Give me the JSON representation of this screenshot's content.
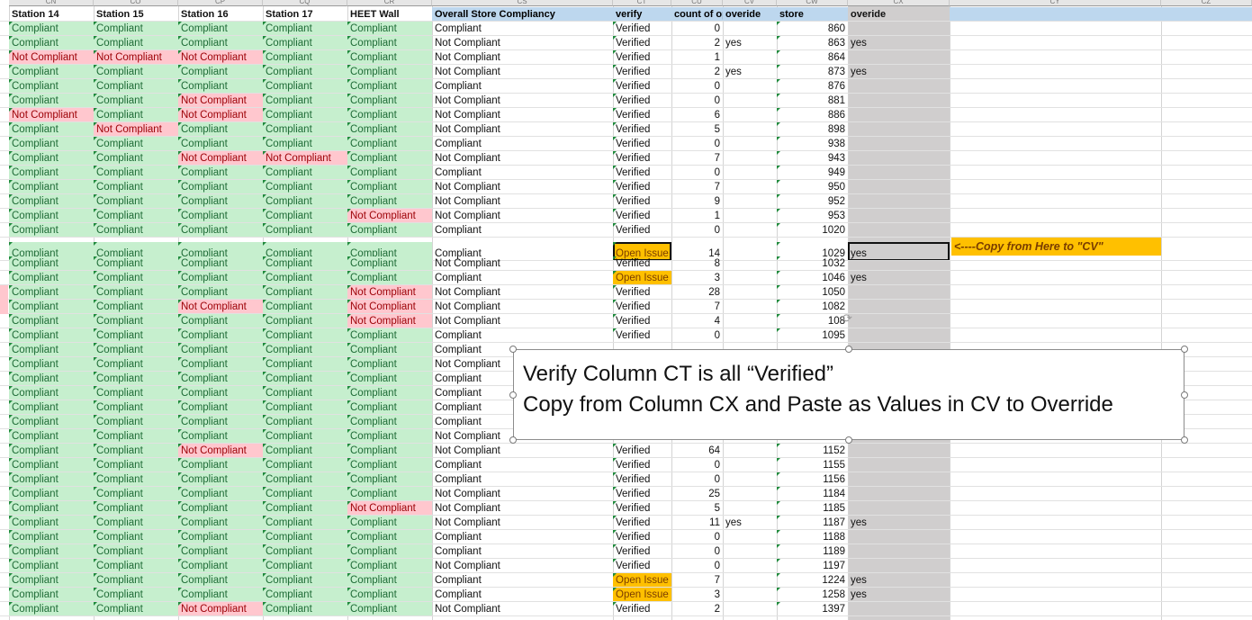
{
  "column_letters": [
    "CN",
    "CO",
    "CP",
    "CQ",
    "CR",
    "CS",
    "CT",
    "CU",
    "CV",
    "CW",
    "CX",
    "CY",
    "CZ"
  ],
  "headers": {
    "station14": "Station 14",
    "station15": "Station 15",
    "station16": "Station 16",
    "station17": "Station 17",
    "heet": "HEET Wall",
    "overall": "Overall Store Compliancy",
    "verify": "verify",
    "count": "count of op",
    "override1": "overide",
    "store": "store",
    "override2": "overide"
  },
  "labels": {
    "compliant": "Compliant",
    "not_compliant": "Not Compliant",
    "verified": "Verified",
    "open_issue": "Open Issue",
    "yes": "yes"
  },
  "rows": [
    {
      "st": [
        "C",
        "C",
        "C",
        "C",
        "C"
      ],
      "overall": "C",
      "verify": "V",
      "count": "0",
      "ov": "",
      "store": "860",
      "cx": ""
    },
    {
      "st": [
        "C",
        "C",
        "C",
        "C",
        "C"
      ],
      "overall": "N",
      "verify": "V",
      "count": "2",
      "ov": "yes",
      "store": "863",
      "cx": "yes"
    },
    {
      "st": [
        "N",
        "N",
        "N",
        "C",
        "C"
      ],
      "overall": "N",
      "verify": "V",
      "count": "1",
      "ov": "",
      "store": "864",
      "cx": ""
    },
    {
      "st": [
        "C",
        "C",
        "C",
        "C",
        "C"
      ],
      "overall": "N",
      "verify": "V",
      "count": "2",
      "ov": "yes",
      "store": "873",
      "cx": "yes"
    },
    {
      "st": [
        "C",
        "C",
        "C",
        "C",
        "C"
      ],
      "overall": "C",
      "verify": "V",
      "count": "0",
      "ov": "",
      "store": "876",
      "cx": ""
    },
    {
      "st": [
        "C",
        "C",
        "N",
        "C",
        "C"
      ],
      "overall": "N",
      "verify": "V",
      "count": "0",
      "ov": "",
      "store": "881",
      "cx": ""
    },
    {
      "st": [
        "N",
        "C",
        "N",
        "C",
        "C"
      ],
      "overall": "N",
      "verify": "V",
      "count": "6",
      "ov": "",
      "store": "886",
      "cx": ""
    },
    {
      "st": [
        "C",
        "N",
        "C",
        "C",
        "C"
      ],
      "overall": "N",
      "verify": "V",
      "count": "5",
      "ov": "",
      "store": "898",
      "cx": ""
    },
    {
      "st": [
        "C",
        "C",
        "C",
        "C",
        "C"
      ],
      "overall": "C",
      "verify": "V",
      "count": "0",
      "ov": "",
      "store": "938",
      "cx": ""
    },
    {
      "st": [
        "C",
        "C",
        "N",
        "N",
        "C"
      ],
      "overall": "N",
      "verify": "V",
      "count": "7",
      "ov": "",
      "store": "943",
      "cx": ""
    },
    {
      "st": [
        "C",
        "C",
        "C",
        "C",
        "C"
      ],
      "overall": "C",
      "verify": "V",
      "count": "0",
      "ov": "",
      "store": "949",
      "cx": ""
    },
    {
      "st": [
        "C",
        "C",
        "C",
        "C",
        "C"
      ],
      "overall": "N",
      "verify": "V",
      "count": "7",
      "ov": "",
      "store": "950",
      "cx": ""
    },
    {
      "st": [
        "C",
        "C",
        "C",
        "C",
        "C"
      ],
      "overall": "N",
      "verify": "V",
      "count": "9",
      "ov": "",
      "store": "952",
      "cx": ""
    },
    {
      "st": [
        "C",
        "C",
        "C",
        "C",
        "N"
      ],
      "overall": "N",
      "verify": "V",
      "count": "1",
      "ov": "",
      "store": "953",
      "cx": ""
    },
    {
      "st": [
        "C",
        "C",
        "C",
        "C",
        "C"
      ],
      "overall": "C",
      "verify": "V",
      "count": "0",
      "ov": "",
      "store": "1020",
      "cx": ""
    },
    {
      "st": [
        "C",
        "C",
        "C",
        "C",
        "C"
      ],
      "overall": "C",
      "verify": "O",
      "count": "14",
      "ov": "",
      "store": "1029",
      "cx": "yes"
    },
    {
      "st": [
        "C",
        "C",
        "C",
        "C",
        "C"
      ],
      "overall": "N",
      "verify": "V",
      "count": "8",
      "ov": "",
      "store": "1032",
      "cx": ""
    },
    {
      "st": [
        "C",
        "C",
        "C",
        "C",
        "C"
      ],
      "overall": "C",
      "verify": "O",
      "count": "3",
      "ov": "",
      "store": "1046",
      "cx": "yes"
    },
    {
      "st": [
        "C",
        "C",
        "C",
        "C",
        "N"
      ],
      "overall": "N",
      "verify": "V",
      "count": "28",
      "ov": "",
      "store": "1050",
      "cx": ""
    },
    {
      "st": [
        "C",
        "C",
        "N",
        "C",
        "N"
      ],
      "overall": "N",
      "verify": "V",
      "count": "7",
      "ov": "",
      "store": "1082",
      "cx": ""
    },
    {
      "st": [
        "C",
        "C",
        "C",
        "C",
        "N"
      ],
      "overall": "N",
      "verify": "V",
      "count": "4",
      "ov": "",
      "store": "108",
      "cx": ""
    },
    {
      "st": [
        "C",
        "C",
        "C",
        "C",
        "C"
      ],
      "overall": "C",
      "verify": "V",
      "count": "0",
      "ov": "",
      "store": "1095",
      "cx": ""
    },
    {
      "st": [
        "C",
        "C",
        "C",
        "C",
        "C"
      ],
      "overall": "C",
      "verify": "",
      "count": "",
      "ov": "",
      "store": "",
      "cx": ""
    },
    {
      "st": [
        "C",
        "C",
        "C",
        "C",
        "C"
      ],
      "overall": "N",
      "verify": "",
      "count": "",
      "ov": "",
      "store": "",
      "cx": ""
    },
    {
      "st": [
        "C",
        "C",
        "C",
        "C",
        "C"
      ],
      "overall": "C",
      "verify": "",
      "count": "",
      "ov": "",
      "store": "",
      "cx": ""
    },
    {
      "st": [
        "C",
        "C",
        "C",
        "C",
        "C"
      ],
      "overall": "C",
      "verify": "",
      "count": "",
      "ov": "",
      "store": "",
      "cx": ""
    },
    {
      "st": [
        "C",
        "C",
        "C",
        "C",
        "C"
      ],
      "overall": "C",
      "verify": "",
      "count": "",
      "ov": "",
      "store": "",
      "cx": ""
    },
    {
      "st": [
        "C",
        "C",
        "C",
        "C",
        "C"
      ],
      "overall": "C",
      "verify": "",
      "count": "",
      "ov": "",
      "store": "",
      "cx": ""
    },
    {
      "st": [
        "C",
        "C",
        "C",
        "C",
        "C"
      ],
      "overall": "N",
      "verify": "",
      "count": "",
      "ov": "",
      "store": "",
      "cx": ""
    },
    {
      "st": [
        "C",
        "C",
        "N",
        "C",
        "C"
      ],
      "overall": "N",
      "verify": "V",
      "count": "64",
      "ov": "",
      "store": "1152",
      "cx": ""
    },
    {
      "st": [
        "C",
        "C",
        "C",
        "C",
        "C"
      ],
      "overall": "C",
      "verify": "V",
      "count": "0",
      "ov": "",
      "store": "1155",
      "cx": ""
    },
    {
      "st": [
        "C",
        "C",
        "C",
        "C",
        "C"
      ],
      "overall": "C",
      "verify": "V",
      "count": "0",
      "ov": "",
      "store": "1156",
      "cx": ""
    },
    {
      "st": [
        "C",
        "C",
        "C",
        "C",
        "C"
      ],
      "overall": "N",
      "verify": "V",
      "count": "25",
      "ov": "",
      "store": "1184",
      "cx": ""
    },
    {
      "st": [
        "C",
        "C",
        "C",
        "C",
        "N"
      ],
      "overall": "N",
      "verify": "V",
      "count": "5",
      "ov": "",
      "store": "1185",
      "cx": ""
    },
    {
      "st": [
        "C",
        "C",
        "C",
        "C",
        "C"
      ],
      "overall": "N",
      "verify": "V",
      "count": "11",
      "ov": "yes",
      "store": "1187",
      "cx": "yes"
    },
    {
      "st": [
        "C",
        "C",
        "C",
        "C",
        "C"
      ],
      "overall": "C",
      "verify": "V",
      "count": "0",
      "ov": "",
      "store": "1188",
      "cx": ""
    },
    {
      "st": [
        "C",
        "C",
        "C",
        "C",
        "C"
      ],
      "overall": "C",
      "verify": "V",
      "count": "0",
      "ov": "",
      "store": "1189",
      "cx": ""
    },
    {
      "st": [
        "C",
        "C",
        "C",
        "C",
        "C"
      ],
      "overall": "N",
      "verify": "V",
      "count": "0",
      "ov": "",
      "store": "1197",
      "cx": ""
    },
    {
      "st": [
        "C",
        "C",
        "C",
        "C",
        "C"
      ],
      "overall": "C",
      "verify": "O",
      "count": "7",
      "ov": "",
      "store": "1224",
      "cx": "yes"
    },
    {
      "st": [
        "C",
        "C",
        "C",
        "C",
        "C"
      ],
      "overall": "C",
      "verify": "O",
      "count": "3",
      "ov": "",
      "store": "1258",
      "cx": "yes"
    },
    {
      "st": [
        "C",
        "C",
        "N",
        "C",
        "C"
      ],
      "overall": "N",
      "verify": "V",
      "count": "2",
      "ov": "",
      "store": "1397",
      "cx": ""
    }
  ],
  "note": "<----Copy from Here to \"CV\"",
  "textbox": {
    "line1": "Verify Column CT is all “Verified”",
    "line2": "Copy from Column CX and Paste as Values in CV to Override"
  },
  "colors": {
    "compliant_fill": "#c6efce",
    "not_compliant_fill": "#ffc7ce",
    "open_issue_fill": "#ffc000",
    "header_fill": "#bdd7ee",
    "override_column_fill": "#d0cece"
  },
  "icons": {
    "cursor": "rotate-handle-icon"
  }
}
